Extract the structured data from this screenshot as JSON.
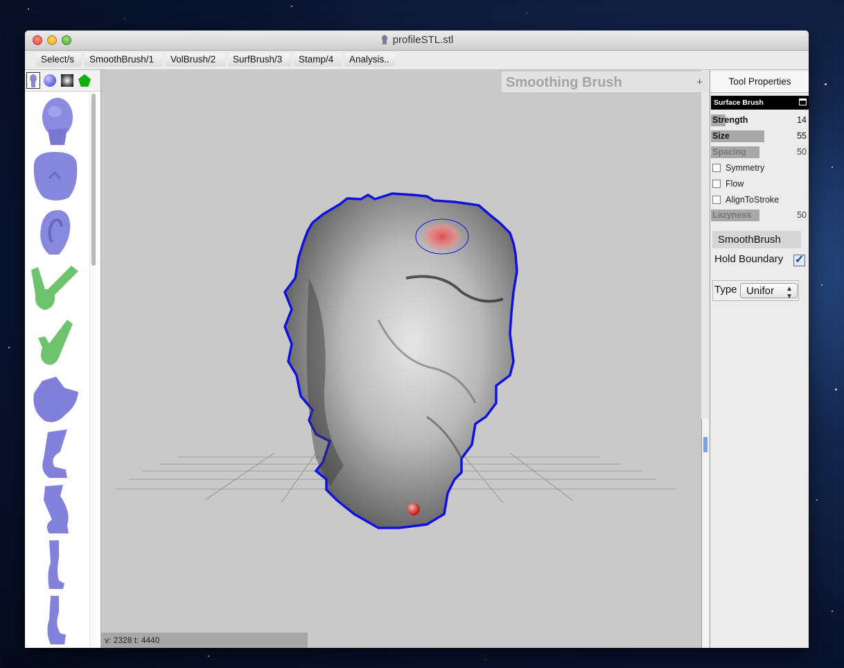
{
  "window": {
    "title": "profileSTL.stl"
  },
  "menu": {
    "items": [
      "Select/s",
      "SmoothBrush/1",
      "VolBrush/2",
      "SurfBrush/3",
      "Stamp/4",
      "Analysis.."
    ]
  },
  "left_panel": {
    "tabs": [
      "head-tab-icon",
      "sphere-tab-icon",
      "texture-tab-icon",
      "pentagon-tab-icon"
    ],
    "shapes": [
      "head",
      "face",
      "ear",
      "hand-peace",
      "hand-point",
      "foot",
      "leg",
      "leg-bent",
      "arm",
      "arm-hand"
    ]
  },
  "viewport": {
    "tool_title": "Smoothing Brush",
    "tool_plus": "+",
    "status": "v: 2328 t: 4440"
  },
  "tool_properties": {
    "header": "Tool Properties",
    "section": "Surface Brush",
    "sliders": [
      {
        "label": "Strength",
        "value": "14",
        "fraction": 0.14,
        "dim": false
      },
      {
        "label": "Size",
        "value": "55",
        "fraction": 0.55,
        "dim": false
      },
      {
        "label": "Spacing",
        "value": "50",
        "fraction": 0.5,
        "dim": true
      }
    ],
    "checkboxes": [
      "Symmetry",
      "Flow",
      "AlignToStroke"
    ],
    "lazyness": {
      "label": "Lazyness",
      "value": "50",
      "fraction": 0.5
    },
    "smooth_button": "SmoothBrush",
    "hold_boundary": {
      "label": "Hold Boundary",
      "checked": true,
      "check_glyph": "✓"
    },
    "type": {
      "label": "Type",
      "value": "Unifor",
      "arrows": "▲▼"
    }
  },
  "colors": {
    "accent_blue": "#1010e0",
    "shape_blue": "#8888e0",
    "shape_green": "#6ec46e",
    "brush_red": "#e05050"
  }
}
